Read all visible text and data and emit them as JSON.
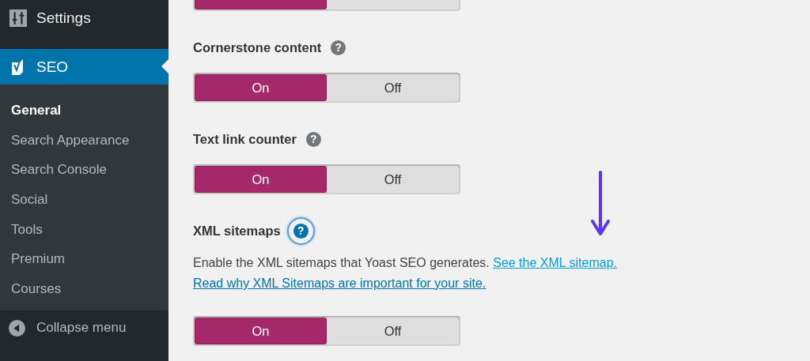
{
  "sidebar": {
    "menu": [
      {
        "label": "Settings",
        "selected": false
      },
      {
        "label": "SEO",
        "selected": true
      }
    ],
    "submenu": [
      {
        "label": "General",
        "selected": true
      },
      {
        "label": "Search Appearance",
        "selected": false
      },
      {
        "label": "Search Console",
        "selected": false
      },
      {
        "label": "Social",
        "selected": false
      },
      {
        "label": "Tools",
        "selected": false
      },
      {
        "label": "Premium",
        "selected": false
      },
      {
        "label": "Courses",
        "selected": false
      }
    ],
    "collapse": "Collapse menu"
  },
  "settings": [
    {
      "options": [
        {
          "selected": true
        },
        {
          "selected": false
        }
      ]
    },
    {
      "title": "Cornerstone content",
      "help": "?",
      "options": [
        {
          "label": "On",
          "selected": true
        },
        {
          "label": "Off",
          "selected": false
        }
      ]
    },
    {
      "title": "Text link counter",
      "help": "?",
      "options": [
        {
          "label": "On",
          "selected": true
        },
        {
          "label": "Off",
          "selected": false
        }
      ]
    },
    {
      "title": "XML sitemaps",
      "help": "?",
      "highlighted": true,
      "description": "Enable the XML sitemaps that Yoast SEO generates.",
      "links": [
        "See the XML sitemap.",
        "Read why XML Sitemaps are important for your site."
      ],
      "options": [
        {
          "label": "On",
          "selected": true
        },
        {
          "label": "Off",
          "selected": false
        }
      ]
    }
  ]
}
